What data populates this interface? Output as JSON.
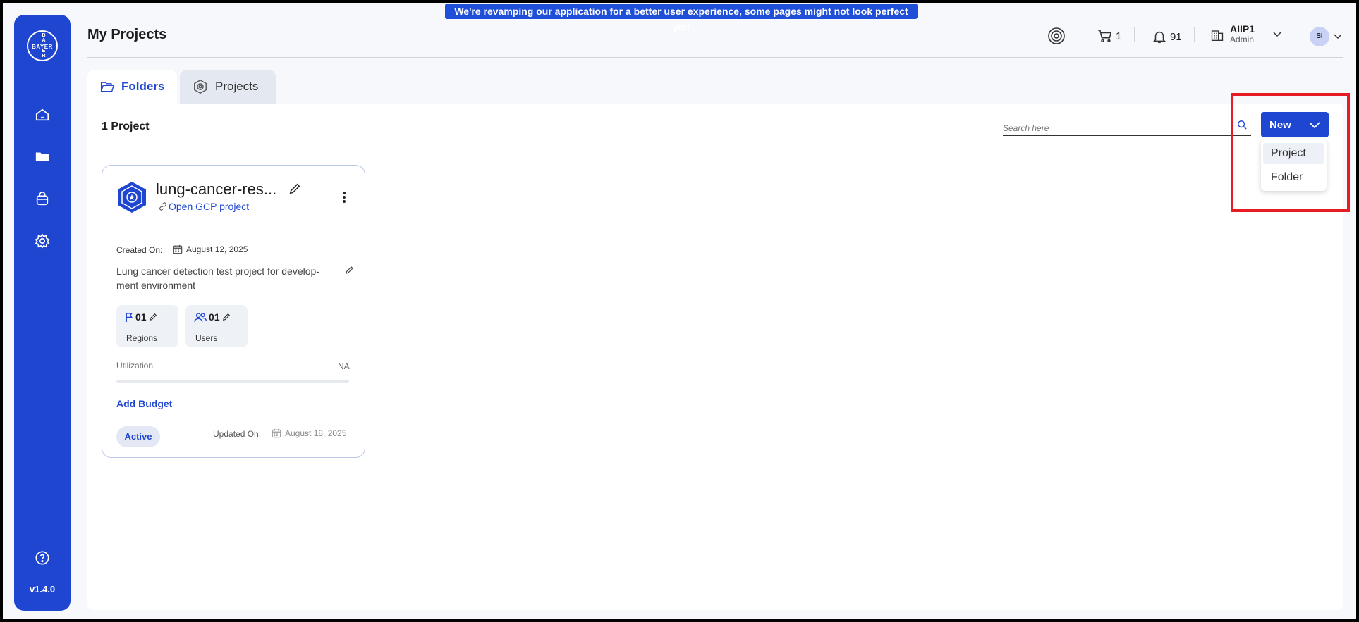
{
  "banner": {
    "text": "We're revamping our application for a better user experience, some pages might not look perfect yet!"
  },
  "sidebar": {
    "logo_text": "BAYER",
    "logo_vertical": [
      "B",
      "A",
      "Y",
      "E",
      "R"
    ],
    "items": [
      {
        "name": "home",
        "icon": "home-icon"
      },
      {
        "name": "folders",
        "icon": "folder-icon"
      },
      {
        "name": "store",
        "icon": "bag-icon"
      },
      {
        "name": "settings",
        "icon": "gear-icon"
      }
    ],
    "help_icon": "help-icon",
    "version": "v1.4.0"
  },
  "header": {
    "title": "My Projects",
    "cart_count": "1",
    "notification_count": "91",
    "user": {
      "org": "AIIP1",
      "role": "Admin",
      "initials": "SI"
    }
  },
  "tabs": [
    {
      "label": "Folders",
      "active": true
    },
    {
      "label": "Projects",
      "active": false
    }
  ],
  "toolbar": {
    "count_label": "1 Project",
    "search_placeholder": "Search here",
    "new_button": "New",
    "new_menu": [
      "Project",
      "Folder"
    ]
  },
  "project_card": {
    "title": "lung-cancer-res...",
    "link_text": "Open GCP project",
    "created_label": "Created On:",
    "created_date": "August 12, 2025",
    "description": "Lung cancer detection test project for develop-ment environment",
    "regions": {
      "value": "01",
      "label": "Regions"
    },
    "users": {
      "value": "01",
      "label": "Users"
    },
    "utilization_label": "Utilization",
    "utilization_value": "NA",
    "add_budget": "Add Budget",
    "status": "Active",
    "updated_label": "Updated On:",
    "updated_date": "August 18, 2025"
  },
  "colors": {
    "primary": "#1f46d0",
    "highlight": "#e51c23"
  }
}
